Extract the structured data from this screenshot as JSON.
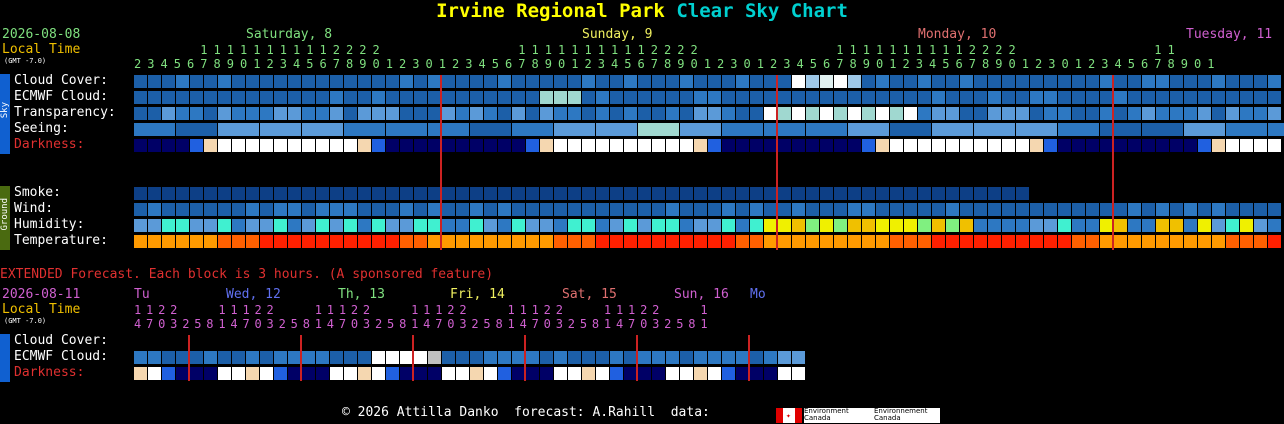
{
  "title": {
    "part1": "Irvine Regional Park",
    "part2": "Clear Sky Chart"
  },
  "colors": {
    "c0": "#0d3f86",
    "c1": "#1c5fa8",
    "c2": "#2d78c2",
    "c3": "#5b9ad8",
    "c4": "#9ec8e8",
    "c5": "#ffffff",
    "dark": "#000066",
    "red": "#cc2222",
    "ground": "#4a6a10",
    "skyband": "#1060d0"
  },
  "header": {
    "date": "2026-08-08",
    "local_time": "Local Time",
    "gmt": "(GMT -7.0)",
    "days": [
      {
        "label": "Saturday, 8",
        "color": "#7fe07f"
      },
      {
        "label": "Sunday, 9",
        "color": "#f0f060"
      },
      {
        "label": "Monday, 10",
        "color": "#e07070"
      },
      {
        "label": "Tuesday, 11",
        "color": "#d060d0"
      }
    ],
    "hours_tens": "          1 1 1 1 1 1 1 1 1 1 2 2 2 2                     1 1 1 1 1 1 1 1 1 1 2 2 2 2                     1 1 1 1 1 1 1 1 1 1 2 2 2 2                     1 1",
    "hours_ones": "2 3 4 5 6 7 8 9 0 1 2 3 4 5 6 7 8 9 0 1 2 3 0 1 2 3 4 5 6 7 8 9 0 1 2 3 4 5 6 7 8 9 0 1 2 3 0 1 2 3 4 5 6 7 8 9 0 1 2 3 4 5 6 7 8 9 0 1 2 3 0 1 2 3 4 5 6 7 8 9 0 1"
  },
  "sections": {
    "sky": "Sky",
    "ground": "Ground"
  },
  "rows": {
    "cloud": "Cloud Cover:",
    "ecmwf": "ECMWF Cloud:",
    "transparency": "Transparency:",
    "seeing": "Seeing:",
    "darkness": "Darkness:",
    "smoke": "Smoke:",
    "wind": "Wind:",
    "humidity": "Humidity:",
    "temperature": "Temperature:"
  },
  "extended": {
    "banner": "EXTENDED Forecast. Each block is 3 hours. (A sponsored feature)",
    "date": "2026-08-11",
    "local_time": "Local Time",
    "gmt": "(GMT -7.0)",
    "days": [
      {
        "label": "Tu",
        "color": "#d060d0"
      },
      {
        "label": "Wed, 12",
        "color": "#6070f0"
      },
      {
        "label": "Th, 13",
        "color": "#7fe07f"
      },
      {
        "label": "Fri, 14",
        "color": "#f0f060"
      },
      {
        "label": "Sat, 15",
        "color": "#e07070"
      },
      {
        "label": "Sun, 16",
        "color": "#d060d0"
      },
      {
        "label": "Mo",
        "color": "#6070f0"
      }
    ],
    "hours_tens": "1 1 2 2       1 1 1 2 2       1 1 1 2 2       1 1 1 2 2       1 1 1 2 2       1 1 1 2 2       1",
    "hours_ones": "4 7 0 3 2 5 8 1 4 7 0 3 2 5 8 1 4 7 0 3 2 5 8 1 4 7 0 3 2 5 8 1 4 7 0 3 2 5 8 1 4 7 0 3 2 5 8 1",
    "rows": {
      "cloud": "Cloud Cover:",
      "ecmwf": "ECMWF Cloud:",
      "darkness": "Darkness:"
    }
  },
  "footer": {
    "text": "© 2026 Attilla Danko  forecast: A.Rahill  data:",
    "env1": "Environment\nCanada",
    "env2": "Environnement\nCanada"
  }
}
